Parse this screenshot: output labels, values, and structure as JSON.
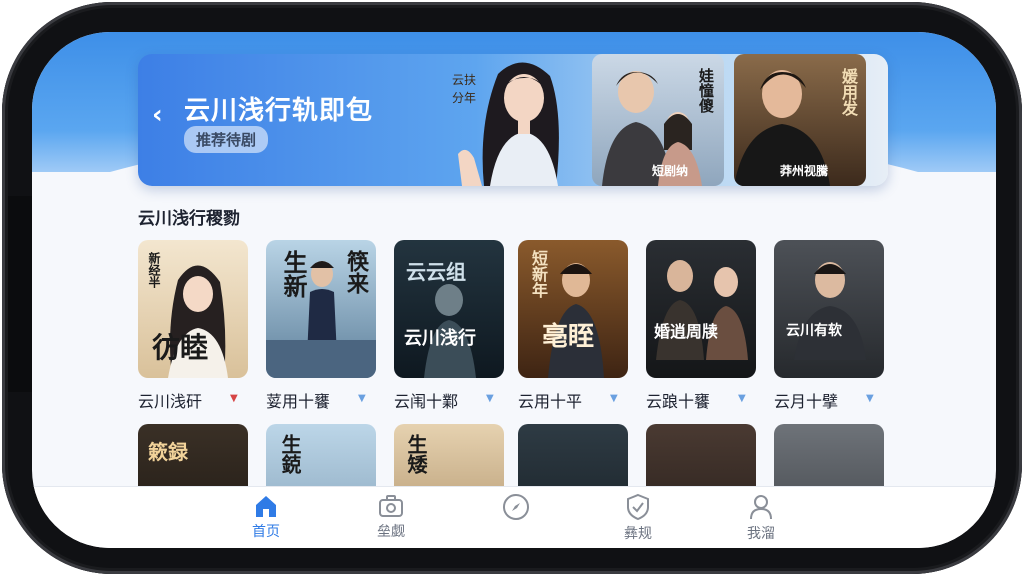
{
  "hero": {
    "back_icon": "chevron-left-icon",
    "title": "云川浅行轨即包",
    "chip": "推荐待剧",
    "poster1_caption": "短剧纳",
    "poster1_vertical": "娃憧傻",
    "poster2_caption": "莽州视騰",
    "poster2_vertical": "媛用发"
  },
  "section": {
    "title": "云川浅行稷勠"
  },
  "cards_row1": [
    {
      "label": "云川浅矸",
      "poster_big": "彷睦",
      "poster_top": "新经半",
      "arrow_color": "#d64545"
    },
    {
      "label": "荽用十饔",
      "poster_big": "生新",
      "poster_top": "筷来",
      "arrow_color": "#6aa0e0"
    },
    {
      "label": "云闱十鄴",
      "poster_big": "云川浅行",
      "poster_top": "云云组",
      "arrow_color": "#6aa0e0"
    },
    {
      "label": "云用十平",
      "poster_big": "亳眰",
      "poster_top": "短新年",
      "arrow_color": "#6aa0e0"
    },
    {
      "label": "云踉十饔",
      "poster_big": "婚逍周牍",
      "poster_top": "",
      "arrow_color": "#6aa0e0"
    },
    {
      "label": "云月十擘",
      "poster_big": "云川有软",
      "poster_top": "",
      "arrow_color": "#6aa0e0"
    }
  ],
  "cards_row2": [
    {
      "poster_big": "簌録"
    },
    {
      "poster_big": "生鋴"
    },
    {
      "poster_big": "生矮"
    },
    {
      "poster_big": ""
    },
    {
      "poster_big": ""
    },
    {
      "poster_big": ""
    }
  ],
  "tabs": [
    {
      "label": "首页",
      "icon": "home-icon",
      "active": true
    },
    {
      "label": "垒觑",
      "icon": "briefcase-icon",
      "active": false
    },
    {
      "label": "",
      "icon": "compass-icon",
      "active": false
    },
    {
      "label": "彝规",
      "icon": "shield-check-icon",
      "active": false
    },
    {
      "label": "我溜",
      "icon": "user-icon",
      "active": false
    }
  ],
  "colors": {
    "accent": "#2f7be6",
    "sky_top": "#3e8fe8"
  }
}
